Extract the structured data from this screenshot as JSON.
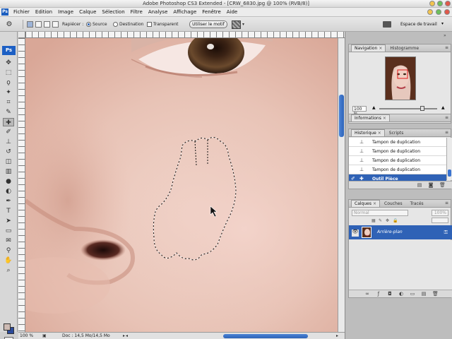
{
  "window": {
    "title": "Adobe Photoshop CS3 Extended - [CRW_6830.jpg @ 100% (RVB/8)]"
  },
  "menu": {
    "logo": "Ps",
    "items": [
      "Fichier",
      "Edition",
      "Image",
      "Calque",
      "Sélection",
      "Filtre",
      "Analyse",
      "Affichage",
      "Fenêtre",
      "Aide"
    ]
  },
  "options": {
    "replace_label": "Rapiécer :",
    "source_label": "Source",
    "destination_label": "Destination",
    "transparent_label": "Transparent",
    "use_pattern_label": "Utiliser le motif",
    "workspace_label": "Espace de travail"
  },
  "toolbox": {
    "logo": "Ps"
  },
  "status": {
    "zoom": "100 %",
    "doc_info": "Doc : 14,5 Mo/14,5 Mo"
  },
  "panels": {
    "navigation": {
      "tabs": [
        "Navigation",
        "Histogramme"
      ],
      "zoom": "100 %"
    },
    "info": {
      "tabs": [
        "Informations"
      ]
    },
    "history": {
      "tabs": [
        "Historique",
        "Scripts"
      ],
      "items": [
        {
          "label": "Tampon de duplication"
        },
        {
          "label": "Tampon de duplication"
        },
        {
          "label": "Tampon de duplication"
        },
        {
          "label": "Tampon de duplication"
        },
        {
          "label": "Outil Pièce"
        }
      ]
    },
    "layers": {
      "tabs": [
        "Calques",
        "Couches",
        "Tracés"
      ],
      "blend_mode": "Normal",
      "opacity": "100%",
      "layer_name": "Arrière-plan"
    }
  },
  "colors": {
    "accent": "#2f62b6",
    "foreground": "#cdbbb4",
    "background": "#2b4a9a"
  }
}
